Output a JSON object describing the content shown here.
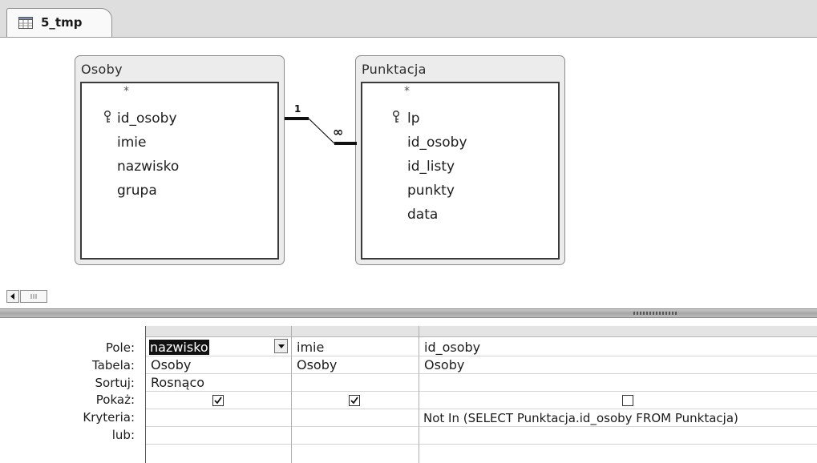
{
  "tab": {
    "title": "5_tmp",
    "icon": "query-design-icon"
  },
  "diagram": {
    "tables": [
      {
        "name": "Osoby",
        "fields": [
          "*",
          "id_osoby",
          "imie",
          "nazwisko",
          "grupa"
        ],
        "primary_key": "id_osoby"
      },
      {
        "name": "Punktacja",
        "fields": [
          "*",
          "lp",
          "id_osoby",
          "id_listy",
          "punkty",
          "data"
        ],
        "primary_key": "lp"
      }
    ],
    "relationship": {
      "one_label": "1",
      "many_label": "∞"
    }
  },
  "grid": {
    "row_labels": [
      "Pole:",
      "Tabela:",
      "Sortuj:",
      "Pokaż:",
      "Kryteria:",
      "lub:"
    ],
    "columns": [
      {
        "field": "nazwisko",
        "table": "Osoby",
        "sort": "Rosnąco",
        "show": true,
        "criteria": ""
      },
      {
        "field": "imie",
        "table": "Osoby",
        "sort": "",
        "show": true,
        "criteria": ""
      },
      {
        "field": "id_osoby",
        "table": "Osoby",
        "sort": "",
        "show": false,
        "criteria": "Not In (SELECT Punktacja.id_osoby FROM Punktacja)"
      }
    ]
  },
  "colors": {
    "tab_bar": "#dedede",
    "table_header": "#ececec",
    "splitter": "#a6a6a6"
  }
}
